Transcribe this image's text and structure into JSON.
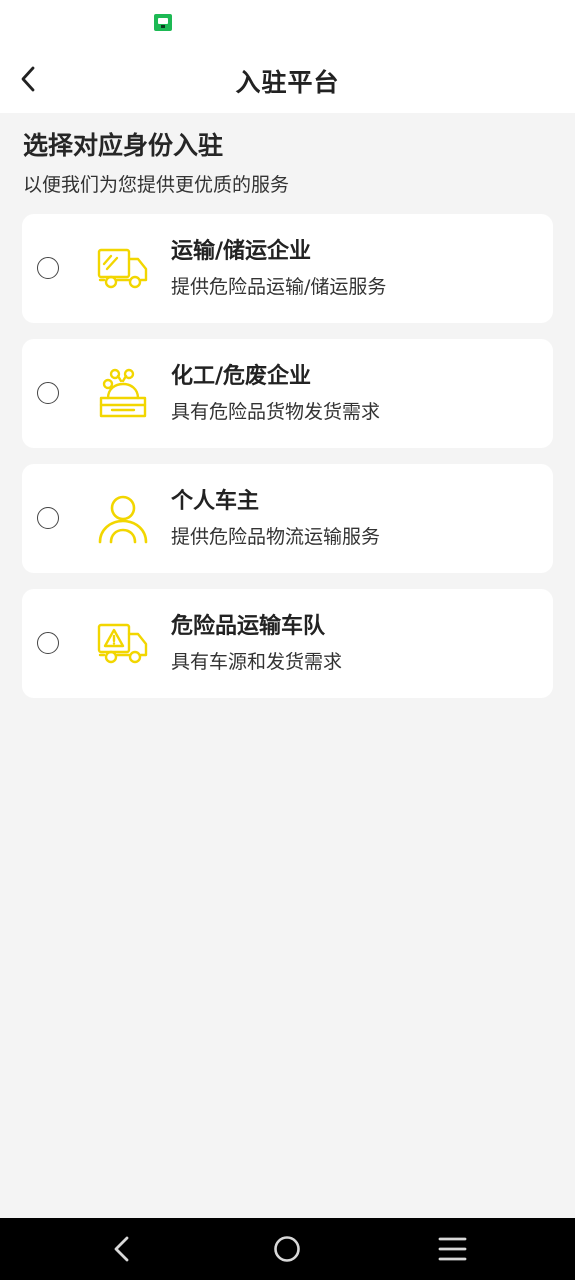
{
  "header": {
    "title": "入驻平台"
  },
  "intro": {
    "title": "选择对应身份入驻",
    "subtitle": "以便我们为您提供更优质的服务"
  },
  "accent_color": "#f2d600",
  "options": [
    {
      "title": "运输/储运企业",
      "description": "提供危险品运输/储运服务",
      "icon": "truck-icon",
      "selected": false
    },
    {
      "title": "化工/危废企业",
      "description": "具有危险品货物发货需求",
      "icon": "chemical-factory-icon",
      "selected": false
    },
    {
      "title": "个人车主",
      "description": "提供危险品物流运输服务",
      "icon": "person-icon",
      "selected": false
    },
    {
      "title": "危险品运输车队",
      "description": "具有车源和发货需求",
      "icon": "hazard-truck-icon",
      "selected": false
    }
  ]
}
